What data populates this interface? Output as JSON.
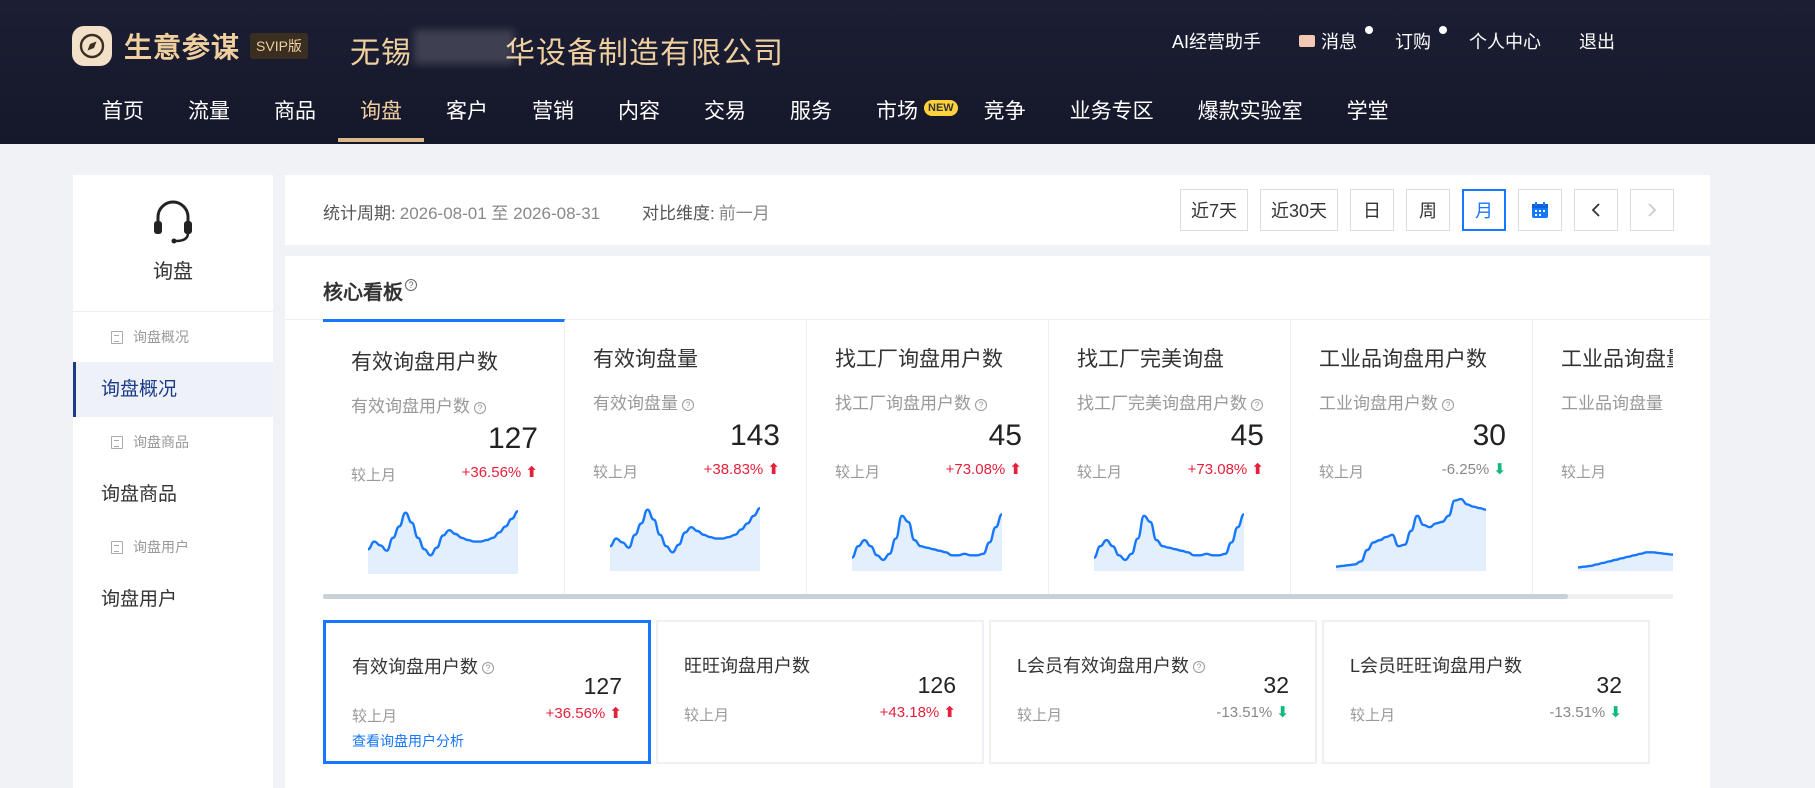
{
  "topbar": {
    "app_name": "生意参谋",
    "edition_badge": "SVIP版",
    "company_name": "无锡　　　华设备制造有限公司",
    "user_links": [
      {
        "label": "AI经营助手",
        "has_dot": false,
        "icon": ""
      },
      {
        "label": "消息",
        "has_dot": true,
        "icon": "mail-icon"
      },
      {
        "label": "订购",
        "has_dot": true,
        "icon": ""
      },
      {
        "label": "个人中心",
        "has_dot": false,
        "icon": ""
      },
      {
        "label": "退出",
        "has_dot": false,
        "icon": ""
      }
    ]
  },
  "nav": {
    "items": [
      "首页",
      "流量",
      "商品",
      "询盘",
      "客户",
      "营销",
      "内容",
      "交易",
      "服务",
      "市场",
      "竞争",
      "业务专区",
      "爆款实验室",
      "学堂"
    ],
    "active": "询盘",
    "new_badge_on": "市场",
    "new_badge_label": "NEW"
  },
  "sidebar": {
    "title": "询盘",
    "icon": "headset-icon",
    "groups": [
      {
        "sub": "询盘概况",
        "main": "询盘概况",
        "active": true
      },
      {
        "sub": "询盘商品",
        "main": "询盘商品",
        "active": false
      },
      {
        "sub": "询盘用户",
        "main": "询盘用户",
        "active": false
      }
    ]
  },
  "filter": {
    "period_label": "统计周期:",
    "period_value": "2026-08-01 至 2026-08-31",
    "compare_label": "对比维度:",
    "compare_value": "前一月",
    "buttons": [
      "近7天",
      "近30天",
      "日",
      "周",
      "月"
    ],
    "selected": "月"
  },
  "panel": {
    "title": "核心看板",
    "compare_label": "较上月",
    "cards": [
      {
        "title": "有效询盘用户数",
        "subtitle": "有效询盘用户数",
        "has_q": true,
        "value": "127",
        "change": "+36.56%",
        "dir": "up",
        "active": true
      },
      {
        "title": "有效询盘量",
        "subtitle": "有效询盘量",
        "has_q": true,
        "value": "143",
        "change": "+38.83%",
        "dir": "up",
        "active": false
      },
      {
        "title": "找工厂询盘用户数",
        "subtitle": "找工厂询盘用户数",
        "has_q": true,
        "value": "45",
        "change": "+73.08%",
        "dir": "up",
        "active": false
      },
      {
        "title": "找工厂完美询盘",
        "subtitle": "找工厂完美询盘用户数",
        "has_q": true,
        "value": "45",
        "change": "+73.08%",
        "dir": "up",
        "active": false
      },
      {
        "title": "工业品询盘用户数",
        "subtitle": "工业询盘用户数",
        "has_q": true,
        "value": "30",
        "change": "-6.25%",
        "dir": "down",
        "active": false
      },
      {
        "title": "工业品询盘量",
        "subtitle": "工业品询盘量",
        "has_q": false,
        "value": "",
        "change": "",
        "dir": "",
        "active": false
      }
    ],
    "sub_cards": [
      {
        "title": "有效询盘用户数",
        "has_q": true,
        "value": "127",
        "change": "+36.56%",
        "dir": "up",
        "link": "查看询盘用户分析",
        "active": true
      },
      {
        "title": "旺旺询盘用户数",
        "has_q": false,
        "value": "126",
        "change": "+43.18%",
        "dir": "up",
        "link": "",
        "active": false
      },
      {
        "title": "L会员有效询盘用户数",
        "has_q": true,
        "value": "32",
        "change": "-13.51%",
        "dir": "down",
        "link": "",
        "active": false
      },
      {
        "title": "L会员旺旺询盘用户数",
        "has_q": false,
        "value": "32",
        "change": "-13.51%",
        "dir": "down",
        "link": "",
        "active": false
      }
    ]
  },
  "sparkline_note": "relative 0-100 heights per day, estimated from unlabeled sparklines",
  "sparklines": [
    [
      30,
      40,
      35,
      28,
      45,
      60,
      78,
      65,
      45,
      30,
      22,
      32,
      48,
      55,
      50,
      45,
      42,
      40,
      40,
      42,
      45,
      52,
      60,
      70,
      80
    ],
    [
      30,
      40,
      35,
      28,
      45,
      60,
      78,
      65,
      45,
      30,
      22,
      32,
      48,
      55,
      50,
      45,
      42,
      40,
      40,
      42,
      45,
      52,
      60,
      70,
      80
    ],
    [
      15,
      30,
      38,
      30,
      18,
      12,
      20,
      40,
      70,
      62,
      38,
      30,
      28,
      26,
      24,
      22,
      18,
      18,
      20,
      18,
      18,
      20,
      35,
      55,
      72
    ],
    [
      15,
      30,
      38,
      30,
      18,
      12,
      20,
      40,
      70,
      62,
      38,
      30,
      28,
      26,
      24,
      22,
      18,
      18,
      20,
      18,
      18,
      20,
      35,
      55,
      72
    ],
    [
      3,
      4,
      5,
      6,
      10,
      25,
      35,
      38,
      42,
      45,
      30,
      32,
      50,
      70,
      58,
      55,
      60,
      62,
      70,
      90,
      92,
      85,
      82,
      80,
      78
    ],
    [
      2,
      3,
      4,
      6,
      8,
      10,
      12,
      14,
      16,
      18,
      20,
      22,
      22,
      21,
      20,
      19,
      18,
      17,
      10,
      8,
      40,
      60,
      90,
      95,
      100
    ]
  ],
  "colors": {
    "accent": "#1677ff",
    "up": "#e5203b",
    "down_arrow": "#10b981",
    "topbar": "#181a2e",
    "brand_gold": "#efcf9e",
    "spark_line": "#1677ff",
    "spark_fill": "#e3effc"
  }
}
